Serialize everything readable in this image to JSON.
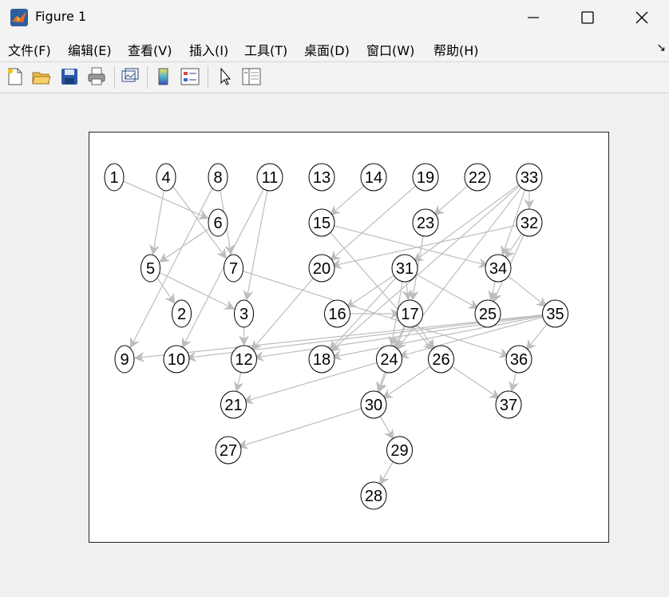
{
  "window": {
    "title": "Figure 1"
  },
  "menu": {
    "items": [
      "文件(F)",
      "编辑(E)",
      "查看(V)",
      "插入(I)",
      "工具(T)",
      "桌面(D)",
      "窗口(W)",
      "帮助(H)"
    ],
    "overflow": "↘"
  },
  "toolbar": {
    "buttons": [
      "new-figure",
      "open-file",
      "save-figure",
      "print-figure",
      "link-plot",
      "insert-colorbar",
      "insert-legend",
      "edit-plot",
      "open-property-inspector"
    ]
  },
  "colors": {
    "edge": "#bdbdbd",
    "node_stroke": "#000000",
    "axes_bg": "#ffffff"
  },
  "chart_data": {
    "type": "directed-graph",
    "nodes": [
      {
        "id": "1",
        "x": 1,
        "y": 1
      },
      {
        "id": "4",
        "x": 2,
        "y": 1
      },
      {
        "id": "8",
        "x": 3,
        "y": 1
      },
      {
        "id": "11",
        "x": 4,
        "y": 1
      },
      {
        "id": "13",
        "x": 5,
        "y": 1
      },
      {
        "id": "14",
        "x": 6,
        "y": 1
      },
      {
        "id": "19",
        "x": 7,
        "y": 1
      },
      {
        "id": "22",
        "x": 8,
        "y": 1
      },
      {
        "id": "33",
        "x": 9,
        "y": 1
      },
      {
        "id": "6",
        "x": 3,
        "y": 2
      },
      {
        "id": "15",
        "x": 5,
        "y": 2
      },
      {
        "id": "23",
        "x": 7,
        "y": 2
      },
      {
        "id": "32",
        "x": 9,
        "y": 2
      },
      {
        "id": "5",
        "x": 1.7,
        "y": 3
      },
      {
        "id": "7",
        "x": 3.3,
        "y": 3
      },
      {
        "id": "20",
        "x": 5,
        "y": 3
      },
      {
        "id": "31",
        "x": 6.6,
        "y": 3
      },
      {
        "id": "34",
        "x": 8.4,
        "y": 3
      },
      {
        "id": "2",
        "x": 2.3,
        "y": 4
      },
      {
        "id": "3",
        "x": 3.5,
        "y": 4
      },
      {
        "id": "16",
        "x": 5.3,
        "y": 4
      },
      {
        "id": "17",
        "x": 6.7,
        "y": 4
      },
      {
        "id": "25",
        "x": 8.2,
        "y": 4
      },
      {
        "id": "35",
        "x": 9.5,
        "y": 4
      },
      {
        "id": "9",
        "x": 1.2,
        "y": 5
      },
      {
        "id": "10",
        "x": 2.2,
        "y": 5
      },
      {
        "id": "12",
        "x": 3.5,
        "y": 5
      },
      {
        "id": "18",
        "x": 5,
        "y": 5
      },
      {
        "id": "24",
        "x": 6.3,
        "y": 5
      },
      {
        "id": "26",
        "x": 7.3,
        "y": 5
      },
      {
        "id": "36",
        "x": 8.8,
        "y": 5
      },
      {
        "id": "21",
        "x": 3.3,
        "y": 6
      },
      {
        "id": "30",
        "x": 6,
        "y": 6
      },
      {
        "id": "37",
        "x": 8.6,
        "y": 6
      },
      {
        "id": "27",
        "x": 3.2,
        "y": 7
      },
      {
        "id": "29",
        "x": 6.5,
        "y": 7
      },
      {
        "id": "28",
        "x": 6,
        "y": 8
      }
    ],
    "edges": [
      [
        "1",
        "6"
      ],
      [
        "4",
        "5"
      ],
      [
        "4",
        "7"
      ],
      [
        "8",
        "9"
      ],
      [
        "8",
        "7"
      ],
      [
        "11",
        "10"
      ],
      [
        "11",
        "3"
      ],
      [
        "14",
        "15"
      ],
      [
        "19",
        "20"
      ],
      [
        "22",
        "23"
      ],
      [
        "33",
        "32"
      ],
      [
        "33",
        "31"
      ],
      [
        "33",
        "34"
      ],
      [
        "33",
        "24"
      ],
      [
        "33",
        "18"
      ],
      [
        "32",
        "34"
      ],
      [
        "32",
        "20"
      ],
      [
        "32",
        "25"
      ],
      [
        "6",
        "5"
      ],
      [
        "5",
        "2"
      ],
      [
        "5",
        "3"
      ],
      [
        "7",
        "36"
      ],
      [
        "15",
        "34"
      ],
      [
        "15",
        "26"
      ],
      [
        "20",
        "12"
      ],
      [
        "23",
        "17"
      ],
      [
        "31",
        "16"
      ],
      [
        "31",
        "17"
      ],
      [
        "31",
        "25"
      ],
      [
        "31",
        "24"
      ],
      [
        "31",
        "18"
      ],
      [
        "34",
        "25"
      ],
      [
        "34",
        "35"
      ],
      [
        "35",
        "36"
      ],
      [
        "35",
        "9"
      ],
      [
        "35",
        "10"
      ],
      [
        "35",
        "12"
      ],
      [
        "35",
        "18"
      ],
      [
        "35",
        "24"
      ],
      [
        "17",
        "24"
      ],
      [
        "17",
        "26"
      ],
      [
        "17",
        "30"
      ],
      [
        "3",
        "12"
      ],
      [
        "12",
        "21"
      ],
      [
        "24",
        "30"
      ],
      [
        "24",
        "21"
      ],
      [
        "26",
        "30"
      ],
      [
        "26",
        "37"
      ],
      [
        "36",
        "37"
      ],
      [
        "30",
        "27"
      ],
      [
        "30",
        "29"
      ],
      [
        "29",
        "28"
      ],
      [
        "16",
        "17"
      ]
    ],
    "node_positions_note": ""
  }
}
